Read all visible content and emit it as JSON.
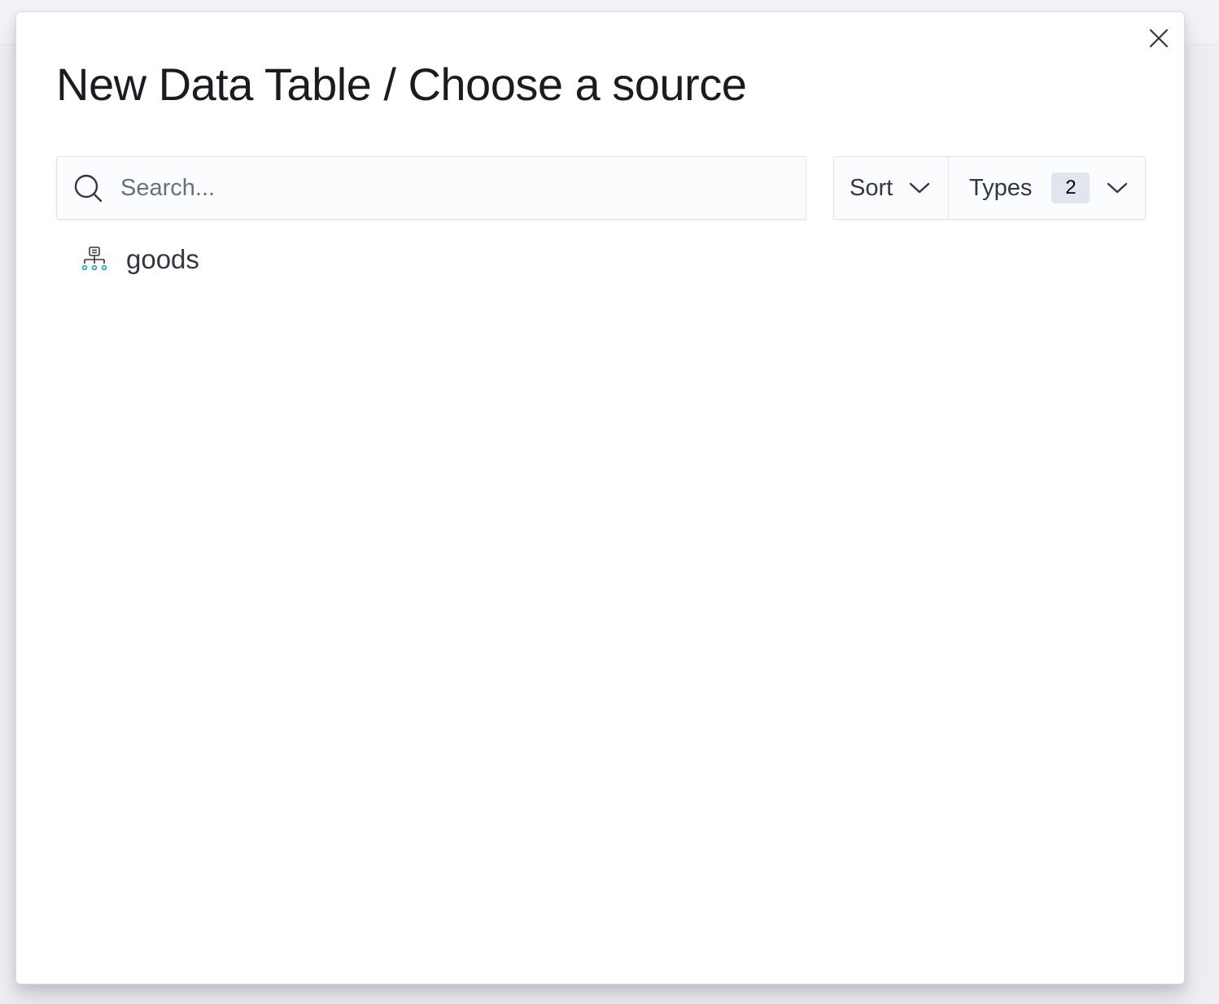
{
  "modal": {
    "title": "New Data Table / Choose a source",
    "close_icon": "close-icon"
  },
  "search": {
    "placeholder": "Search...",
    "value": "",
    "icon": "search-icon"
  },
  "filters": {
    "sort_label": "Sort",
    "types_label": "Types",
    "types_count": "2"
  },
  "sources": [
    {
      "label": "goods",
      "icon": "index-pattern-icon"
    }
  ],
  "colors": {
    "title_text": "#1a1c21",
    "body_text": "#343741",
    "placeholder_text": "#69707d",
    "badge_bg": "#e0e5ee",
    "border": "#dfe3ea",
    "icon_accent": "#00a69b"
  }
}
